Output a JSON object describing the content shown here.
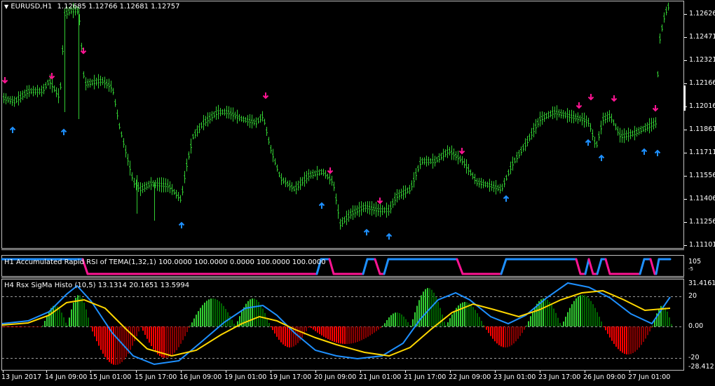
{
  "main_chart": {
    "symbol": "EURUSD,H1",
    "ohlc": "1.12685 1.12766 1.12681 1.12757",
    "price_labels": [
      "1.12626",
      "1.12471",
      "1.12321",
      "1.12166",
      "1.12016",
      "1.11861",
      "1.11711",
      "1.11556",
      "1.11406",
      "1.11256",
      "1.11101"
    ],
    "up_arrow_color": "#1E90FF",
    "down_arrow_color": "#FF1493",
    "bar_color": "#32CD32"
  },
  "rsi_panel": {
    "title": "H1 Accumulated Rapid RSI of TEMA(1,32,1) 100.0000 100.0000 0.0000 100.0000 100.0000",
    "scale_top": "105",
    "scale_bottom": "-5",
    "line_color_up": "#1E90FF",
    "line_color_down": "#FF1493"
  },
  "sigma_panel": {
    "title": "H4  Rsx SigMa Histo (10,5) 13.1314 20.1651 13.5994",
    "scale_labels": [
      "31.4161",
      "20",
      "0.00",
      "-20",
      "-28.412"
    ],
    "colors": {
      "histo_up": "#32CD32",
      "histo_up_dark": "#006400",
      "histo_down": "#FF0000",
      "histo_down_dark": "#8B0000",
      "line_fast": "#1E90FF",
      "line_slow": "#FFD700"
    }
  },
  "time_axis": [
    "13 Jun 2017",
    "14 Jun 09:00",
    "15 Jun 01:00",
    "15 Jun 17:00",
    "16 Jun 09:00",
    "19 Jun 01:00",
    "19 Jun 17:00",
    "20 Jun 09:00",
    "21 Jun 01:00",
    "21 Jun 17:00",
    "22 Jun 09:00",
    "23 Jun 01:00",
    "23 Jun 17:00",
    "26 Jun 09:00",
    "27 Jun 01:00"
  ]
}
